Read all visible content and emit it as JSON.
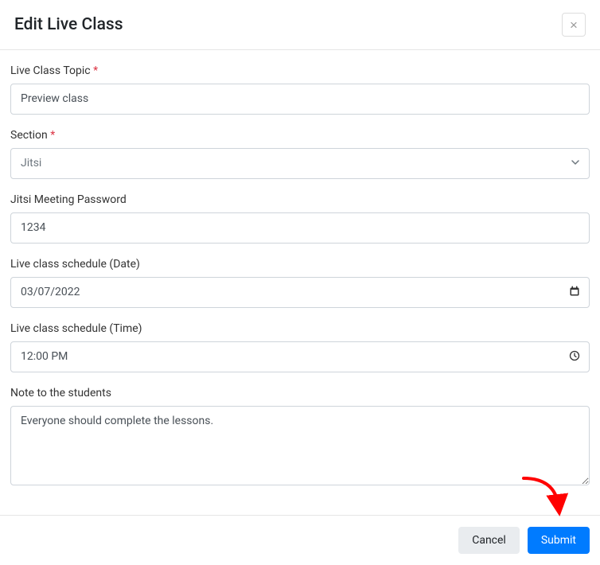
{
  "header": {
    "title": "Edit Live Class"
  },
  "form": {
    "topic": {
      "label": "Live Class Topic",
      "required": "*",
      "value": "Preview class"
    },
    "section": {
      "label": "Section",
      "required": "*",
      "value": "Jitsi"
    },
    "password": {
      "label": "Jitsi Meeting Password",
      "value": "1234"
    },
    "date": {
      "label": "Live class schedule (Date)",
      "value": "03/07/2022"
    },
    "time": {
      "label": "Live class schedule (Time)",
      "value": "12:00 PM"
    },
    "note": {
      "label": "Note to the students",
      "value": "Everyone should complete the lessons."
    }
  },
  "footer": {
    "cancel": "Cancel",
    "submit": "Submit"
  }
}
